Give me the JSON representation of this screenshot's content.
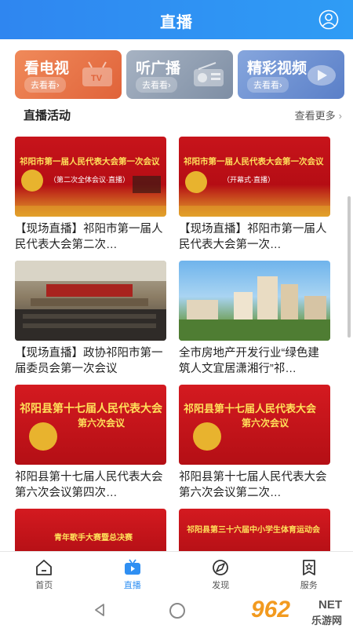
{
  "header": {
    "title": "直播"
  },
  "cards": [
    {
      "title": "看电视",
      "sub": "去看看›",
      "icon": "tv-icon"
    },
    {
      "title": "听广播",
      "sub": "去看看›",
      "icon": "radio-icon"
    },
    {
      "title": "精彩视频",
      "sub": "去看看›",
      "icon": "play-icon"
    }
  ],
  "section": {
    "title": "直播活动",
    "more": "查看更多",
    "chevron": "›"
  },
  "items": [
    {
      "caption": "【现场直播】祁阳市第一届人民代表大会第二次…",
      "thumb_title": "祁阳市第一届人民代表大会第一次会议",
      "thumb_sub": "（第二次全体会议·直播）"
    },
    {
      "caption": "【现场直播】祁阳市第一届人民代表大会第一次…",
      "thumb_title": "祁阳市第一届人民代表大会第一次会议",
      "thumb_sub": "（开幕式·直播）"
    },
    {
      "caption": "【现场直播】政协祁阳市第一届委员会第一次会议",
      "thumb_title": "",
      "thumb_sub": ""
    },
    {
      "caption": "全市房地产开发行业“绿色建筑人文宜居潇湘行”祁…",
      "thumb_title": "",
      "thumb_sub": ""
    },
    {
      "caption": "祁阳县第十七届人民代表大会第六次会议第四次…",
      "thumb_title": "祁阳县第十七届人民代表大会",
      "thumb_sub": "第六次会议"
    },
    {
      "caption": "祁阳县第十七届人民代表大会第六次会议第二次…",
      "thumb_title": "祁阳县第十七届人民代表大会",
      "thumb_sub": "第六次会议"
    },
    {
      "caption": "",
      "thumb_title": "青年歌手大赛暨总决赛",
      "thumb_sub": ""
    },
    {
      "caption": "",
      "thumb_title": "祁阳县第三十六届中小学生体育运动会",
      "thumb_sub": ""
    }
  ],
  "tabs": [
    {
      "label": "首页",
      "icon": "home-icon",
      "active": false
    },
    {
      "label": "直播",
      "icon": "live-tv-icon",
      "active": true
    },
    {
      "label": "发现",
      "icon": "compass-icon",
      "active": false
    },
    {
      "label": "服务",
      "icon": "star-bookmark-icon",
      "active": false
    }
  ],
  "watermark": {
    "num": "962",
    "net": "NET",
    "sub": "乐游网"
  },
  "colors": {
    "primary": "#2f8ff2",
    "tv_card": "#e8744a",
    "radio_card": "#93a1b5",
    "video_card": "#6f93d3"
  }
}
